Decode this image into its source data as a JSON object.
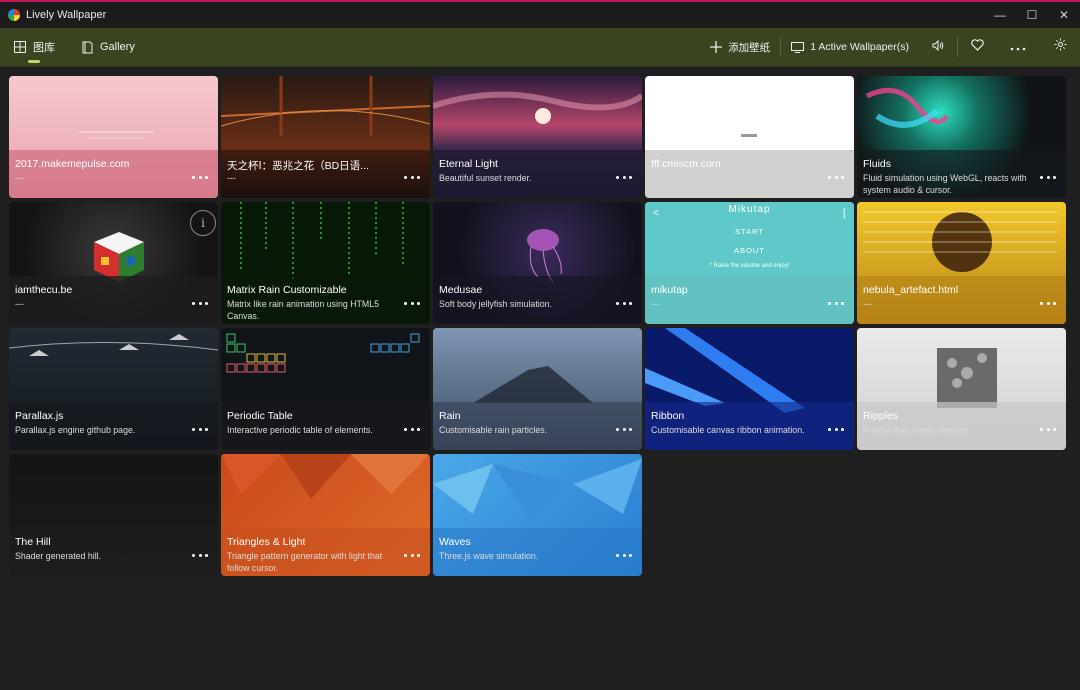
{
  "window": {
    "title": "Lively Wallpaper",
    "minimize": "—",
    "maximize": "☐",
    "close": "✕"
  },
  "toolbar": {
    "tabs": [
      {
        "label": "图库",
        "active": true
      },
      {
        "label": "Gallery",
        "active": false
      }
    ],
    "add_label": "添加壁纸",
    "active_label": "1 Active Wallpaper(s)"
  },
  "colors": {
    "accent": "#b8d76a",
    "toolbar": "#3a4421",
    "selected_outline": "#c9e56a"
  },
  "wallpapers": [
    {
      "title": "2017.makemepulse.com",
      "desc": "---",
      "theme": "pink"
    },
    {
      "title": "天之杯Ⅰ：恶兆之花（BD日语...",
      "desc": "---",
      "theme": "bridge"
    },
    {
      "title": "Eternal Light",
      "desc": "Beautiful sunset render.",
      "theme": "sunset"
    },
    {
      "title": "fff.cmiscm.com",
      "desc": "---",
      "theme": "white"
    },
    {
      "title": "Fluids",
      "desc": "Fluid simulation using WebGL, reacts with system audio & cursor.",
      "theme": "fluids"
    },
    {
      "title": "iamthecu.be",
      "desc": "---",
      "theme": "cube",
      "info": true
    },
    {
      "title": "Matrix Rain Customizable",
      "desc": "Matrix like rain animation using HTML5 Canvas.",
      "theme": "matrix"
    },
    {
      "title": "Medusae",
      "desc": "Soft body jellyfish simulation.",
      "theme": "jelly"
    },
    {
      "title": "mikutap",
      "desc": "---",
      "theme": "miku",
      "selected": true,
      "text": {
        "name": "Mikutap",
        "start": "START",
        "about": "ABOUT",
        "hint": "* Raise the volume and enjoy!"
      }
    },
    {
      "title": "nebula_artefact.html",
      "desc": "---",
      "theme": "nebula"
    },
    {
      "title": "Parallax.js",
      "desc": "Parallax.js engine github page.",
      "theme": "parallax"
    },
    {
      "title": "Periodic Table",
      "desc": "Interactive periodic table of elements.",
      "theme": "periodic"
    },
    {
      "title": "Rain",
      "desc": "Customisable rain particles.",
      "theme": "rain"
    },
    {
      "title": "Ribbon",
      "desc": "Customisable canvas ribbon animation.",
      "theme": "ribbon"
    },
    {
      "title": "Ripples",
      "desc": "Puddle that shows weather.",
      "theme": "ripples"
    },
    {
      "title": "The Hill",
      "desc": "Shader generated hill.",
      "theme": "hill"
    },
    {
      "title": "Triangles & Light",
      "desc": "Triangle pattern generator with light that follow cursor.",
      "theme": "triangles"
    },
    {
      "title": "Waves",
      "desc": "Three.js wave simulation.",
      "theme": "waves"
    }
  ]
}
